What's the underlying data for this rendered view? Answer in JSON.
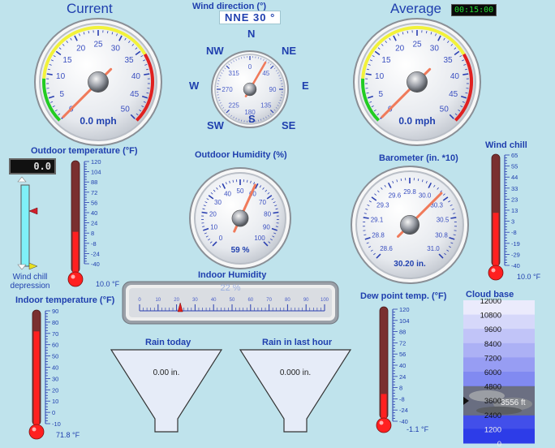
{
  "wind_current": {
    "title": "Current",
    "readout": "0.0 mph",
    "ticks": [
      "0",
      "5",
      "10",
      "15",
      "20",
      "25",
      "30",
      "35",
      "40",
      "45",
      "50"
    ],
    "value": 0
  },
  "wind_average": {
    "title": "Average",
    "timer": "00:15:00",
    "readout": "0.0 mph",
    "ticks": [
      "0",
      "5",
      "10",
      "15",
      "20",
      "25",
      "30",
      "35",
      "40",
      "45",
      "50"
    ],
    "value": 0
  },
  "wind_direction": {
    "title": "Wind direction (°)",
    "readout": "NNE  30 °",
    "compass": [
      "N",
      "NE",
      "E",
      "SE",
      "S",
      "SW",
      "W",
      "NW"
    ],
    "dial_ticks": [
      "0",
      "45",
      "90",
      "135",
      "180",
      "225",
      "270",
      "315"
    ],
    "value_deg": 30
  },
  "outdoor_humidity": {
    "title": "Outdoor Humidity (%)",
    "readout": "59 %",
    "ticks": [
      "0",
      "10",
      "20",
      "30",
      "40",
      "50",
      "60",
      "70",
      "80",
      "90",
      "100"
    ],
    "value": 59
  },
  "barometer": {
    "title": "Barometer (in. *10)",
    "readout": "30.20 in.",
    "ticks": [
      "28.6",
      "28.8",
      "29.1",
      "29.3",
      "29.6",
      "29.8",
      "30.0",
      "30.3",
      "30.5",
      "30.8",
      "31.0"
    ],
    "value": 30.2
  },
  "outdoor_temp": {
    "title": "Outdoor temperature (°F)",
    "readout": "10.0 °F",
    "scale": [
      "120",
      "104",
      "88",
      "72",
      "56",
      "40",
      "24",
      "8",
      "-8",
      "-24",
      "-40"
    ],
    "value": 10.0
  },
  "wind_chill_depression": {
    "lcd": "0.0",
    "label_line1": "Wind chill",
    "label_line2": "depression"
  },
  "wind_chill": {
    "title": "Wind chill",
    "readout": "10.0 °F",
    "scale": [
      "65",
      "55",
      "44",
      "33",
      "23",
      "13",
      "3",
      "-8",
      "-19",
      "-29",
      "-40"
    ],
    "value": 10.0
  },
  "indoor_temp": {
    "title": "Indoor temperature (°F)",
    "readout": "71.8 °F",
    "scale": [
      "90",
      "80",
      "70",
      "60",
      "50",
      "40",
      "30",
      "20",
      "10",
      "0",
      "-10"
    ],
    "value": 71.8
  },
  "indoor_humidity": {
    "title": "Indoor Humidity",
    "readout": "22 %",
    "ticks": [
      "0",
      "10",
      "20",
      "30",
      "40",
      "50",
      "60",
      "70",
      "80",
      "90",
      "100"
    ],
    "value": 22
  },
  "rain_today": {
    "title": "Rain today",
    "readout": "0.00 in."
  },
  "rain_last_hour": {
    "title": "Rain in last hour",
    "readout": "0.000 in."
  },
  "dew_point": {
    "title": "Dew point temp. (°F)",
    "readout": "-1.1 °F",
    "scale": [
      "120",
      "104",
      "88",
      "72",
      "56",
      "40",
      "24",
      "8",
      "-8",
      "-24",
      "-40"
    ],
    "value": -1.1
  },
  "cloud_base": {
    "title": "Cloud base",
    "scale": [
      "12000",
      "10800",
      "9600",
      "8400",
      "7200",
      "6000",
      "4800",
      "3600",
      "2400",
      "1200",
      "0"
    ],
    "readout": "3556 ft",
    "value": 3556
  }
}
